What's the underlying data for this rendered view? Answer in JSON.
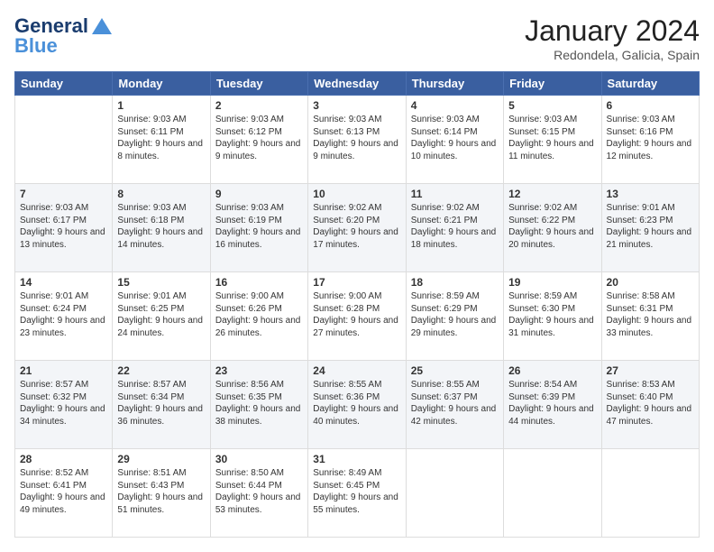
{
  "header": {
    "logo_line1": "General",
    "logo_line2": "Blue",
    "month_year": "January 2024",
    "location": "Redondela, Galicia, Spain"
  },
  "days_of_week": [
    "Sunday",
    "Monday",
    "Tuesday",
    "Wednesday",
    "Thursday",
    "Friday",
    "Saturday"
  ],
  "weeks": [
    [
      {
        "day": "",
        "sunrise": "",
        "sunset": "",
        "daylight": "",
        "empty": true
      },
      {
        "day": "1",
        "sunrise": "Sunrise: 9:03 AM",
        "sunset": "Sunset: 6:11 PM",
        "daylight": "Daylight: 9 hours and 8 minutes."
      },
      {
        "day": "2",
        "sunrise": "Sunrise: 9:03 AM",
        "sunset": "Sunset: 6:12 PM",
        "daylight": "Daylight: 9 hours and 9 minutes."
      },
      {
        "day": "3",
        "sunrise": "Sunrise: 9:03 AM",
        "sunset": "Sunset: 6:13 PM",
        "daylight": "Daylight: 9 hours and 9 minutes."
      },
      {
        "day": "4",
        "sunrise": "Sunrise: 9:03 AM",
        "sunset": "Sunset: 6:14 PM",
        "daylight": "Daylight: 9 hours and 10 minutes."
      },
      {
        "day": "5",
        "sunrise": "Sunrise: 9:03 AM",
        "sunset": "Sunset: 6:15 PM",
        "daylight": "Daylight: 9 hours and 11 minutes."
      },
      {
        "day": "6",
        "sunrise": "Sunrise: 9:03 AM",
        "sunset": "Sunset: 6:16 PM",
        "daylight": "Daylight: 9 hours and 12 minutes."
      }
    ],
    [
      {
        "day": "7",
        "sunrise": "Sunrise: 9:03 AM",
        "sunset": "Sunset: 6:17 PM",
        "daylight": "Daylight: 9 hours and 13 minutes."
      },
      {
        "day": "8",
        "sunrise": "Sunrise: 9:03 AM",
        "sunset": "Sunset: 6:18 PM",
        "daylight": "Daylight: 9 hours and 14 minutes."
      },
      {
        "day": "9",
        "sunrise": "Sunrise: 9:03 AM",
        "sunset": "Sunset: 6:19 PM",
        "daylight": "Daylight: 9 hours and 16 minutes."
      },
      {
        "day": "10",
        "sunrise": "Sunrise: 9:02 AM",
        "sunset": "Sunset: 6:20 PM",
        "daylight": "Daylight: 9 hours and 17 minutes."
      },
      {
        "day": "11",
        "sunrise": "Sunrise: 9:02 AM",
        "sunset": "Sunset: 6:21 PM",
        "daylight": "Daylight: 9 hours and 18 minutes."
      },
      {
        "day": "12",
        "sunrise": "Sunrise: 9:02 AM",
        "sunset": "Sunset: 6:22 PM",
        "daylight": "Daylight: 9 hours and 20 minutes."
      },
      {
        "day": "13",
        "sunrise": "Sunrise: 9:01 AM",
        "sunset": "Sunset: 6:23 PM",
        "daylight": "Daylight: 9 hours and 21 minutes."
      }
    ],
    [
      {
        "day": "14",
        "sunrise": "Sunrise: 9:01 AM",
        "sunset": "Sunset: 6:24 PM",
        "daylight": "Daylight: 9 hours and 23 minutes."
      },
      {
        "day": "15",
        "sunrise": "Sunrise: 9:01 AM",
        "sunset": "Sunset: 6:25 PM",
        "daylight": "Daylight: 9 hours and 24 minutes."
      },
      {
        "day": "16",
        "sunrise": "Sunrise: 9:00 AM",
        "sunset": "Sunset: 6:26 PM",
        "daylight": "Daylight: 9 hours and 26 minutes."
      },
      {
        "day": "17",
        "sunrise": "Sunrise: 9:00 AM",
        "sunset": "Sunset: 6:28 PM",
        "daylight": "Daylight: 9 hours and 27 minutes."
      },
      {
        "day": "18",
        "sunrise": "Sunrise: 8:59 AM",
        "sunset": "Sunset: 6:29 PM",
        "daylight": "Daylight: 9 hours and 29 minutes."
      },
      {
        "day": "19",
        "sunrise": "Sunrise: 8:59 AM",
        "sunset": "Sunset: 6:30 PM",
        "daylight": "Daylight: 9 hours and 31 minutes."
      },
      {
        "day": "20",
        "sunrise": "Sunrise: 8:58 AM",
        "sunset": "Sunset: 6:31 PM",
        "daylight": "Daylight: 9 hours and 33 minutes."
      }
    ],
    [
      {
        "day": "21",
        "sunrise": "Sunrise: 8:57 AM",
        "sunset": "Sunset: 6:32 PM",
        "daylight": "Daylight: 9 hours and 34 minutes."
      },
      {
        "day": "22",
        "sunrise": "Sunrise: 8:57 AM",
        "sunset": "Sunset: 6:34 PM",
        "daylight": "Daylight: 9 hours and 36 minutes."
      },
      {
        "day": "23",
        "sunrise": "Sunrise: 8:56 AM",
        "sunset": "Sunset: 6:35 PM",
        "daylight": "Daylight: 9 hours and 38 minutes."
      },
      {
        "day": "24",
        "sunrise": "Sunrise: 8:55 AM",
        "sunset": "Sunset: 6:36 PM",
        "daylight": "Daylight: 9 hours and 40 minutes."
      },
      {
        "day": "25",
        "sunrise": "Sunrise: 8:55 AM",
        "sunset": "Sunset: 6:37 PM",
        "daylight": "Daylight: 9 hours and 42 minutes."
      },
      {
        "day": "26",
        "sunrise": "Sunrise: 8:54 AM",
        "sunset": "Sunset: 6:39 PM",
        "daylight": "Daylight: 9 hours and 44 minutes."
      },
      {
        "day": "27",
        "sunrise": "Sunrise: 8:53 AM",
        "sunset": "Sunset: 6:40 PM",
        "daylight": "Daylight: 9 hours and 47 minutes."
      }
    ],
    [
      {
        "day": "28",
        "sunrise": "Sunrise: 8:52 AM",
        "sunset": "Sunset: 6:41 PM",
        "daylight": "Daylight: 9 hours and 49 minutes."
      },
      {
        "day": "29",
        "sunrise": "Sunrise: 8:51 AM",
        "sunset": "Sunset: 6:43 PM",
        "daylight": "Daylight: 9 hours and 51 minutes."
      },
      {
        "day": "30",
        "sunrise": "Sunrise: 8:50 AM",
        "sunset": "Sunset: 6:44 PM",
        "daylight": "Daylight: 9 hours and 53 minutes."
      },
      {
        "day": "31",
        "sunrise": "Sunrise: 8:49 AM",
        "sunset": "Sunset: 6:45 PM",
        "daylight": "Daylight: 9 hours and 55 minutes."
      },
      {
        "day": "",
        "sunrise": "",
        "sunset": "",
        "daylight": "",
        "empty": true
      },
      {
        "day": "",
        "sunrise": "",
        "sunset": "",
        "daylight": "",
        "empty": true
      },
      {
        "day": "",
        "sunrise": "",
        "sunset": "",
        "daylight": "",
        "empty": true
      }
    ]
  ]
}
